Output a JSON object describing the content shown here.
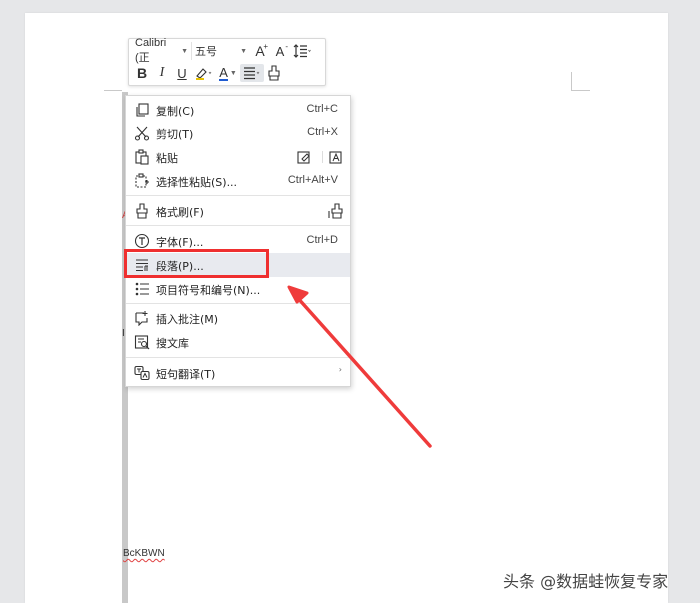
{
  "toolbar": {
    "font_name": "Calibri (正",
    "font_size": "五号",
    "grow_font_icon": "A",
    "shrink_font_icon": "A",
    "bold": "B",
    "italic": "I",
    "underline": "U",
    "font_color_icon": "A"
  },
  "menu": {
    "items": [
      {
        "label": "复制(C)",
        "shortcut": "Ctrl+C",
        "icon": "copy-icon"
      },
      {
        "label": "剪切(T)",
        "shortcut": "Ctrl+X",
        "icon": "scissors-icon"
      },
      {
        "label": "粘贴",
        "shortcut": "",
        "icon": "paste-icon"
      },
      {
        "label": "选择性粘贴(S)...",
        "shortcut": "Ctrl+Alt+V",
        "icon": "paste-special-icon"
      },
      {
        "label": "格式刷(F)",
        "shortcut": "",
        "icon": "format-painter-icon"
      },
      {
        "label": "字体(F)...",
        "shortcut": "Ctrl+D",
        "icon": "font-icon"
      },
      {
        "label": "段落(P)...",
        "shortcut": "",
        "icon": "paragraph-icon",
        "highlighted": true
      },
      {
        "label": "项目符号和编号(N)...",
        "shortcut": "",
        "icon": "bullets-icon"
      },
      {
        "label": "插入批注(M)",
        "shortcut": "",
        "icon": "comment-icon"
      },
      {
        "label": "搜文库",
        "shortcut": "",
        "icon": "search-library-icon"
      },
      {
        "label": "短句翻译(T)",
        "shortcut": "",
        "icon": "translate-icon",
        "submenu": "›"
      }
    ]
  },
  "document": {
    "fragment_text": "BcKBWN",
    "fragment_a": "A",
    "fragment_b": "I"
  },
  "watermark": "头条 @数据蛙恢复专家",
  "colors": {
    "highlight_red": "#ef2f2f",
    "menu_hover": "#e8eaef",
    "font_color_blue": "#1f5bd1"
  }
}
